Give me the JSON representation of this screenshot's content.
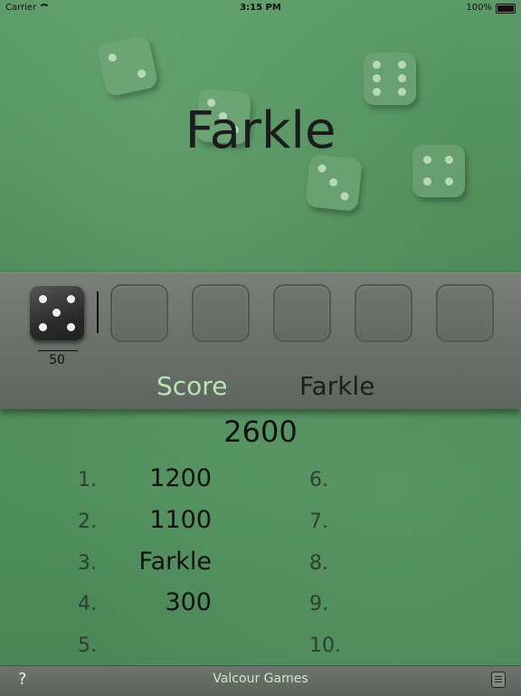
{
  "status_bar": {
    "carrier": "Carrier",
    "time": "3:15 PM",
    "battery": "100%"
  },
  "app": {
    "title": "Farkle"
  },
  "held_dice": {
    "score": "50"
  },
  "labels": {
    "score": "Score",
    "farkle": "Farkle"
  },
  "total_score": "2600",
  "rounds": [
    {
      "num": "1.",
      "value": "1200"
    },
    {
      "num": "2.",
      "value": "1100"
    },
    {
      "num": "3.",
      "value": "Farkle"
    },
    {
      "num": "4.",
      "value": "300"
    },
    {
      "num": "5.",
      "value": ""
    },
    {
      "num": "6.",
      "value": ""
    },
    {
      "num": "7.",
      "value": ""
    },
    {
      "num": "8.",
      "value": ""
    },
    {
      "num": "9.",
      "value": ""
    },
    {
      "num": "10.",
      "value": ""
    }
  ],
  "footer": {
    "help": "?",
    "brand": "Valcour Games"
  },
  "icons": {
    "help": "question-icon",
    "menu": "list-icon",
    "wifi": "wifi-icon",
    "battery": "battery-icon"
  }
}
